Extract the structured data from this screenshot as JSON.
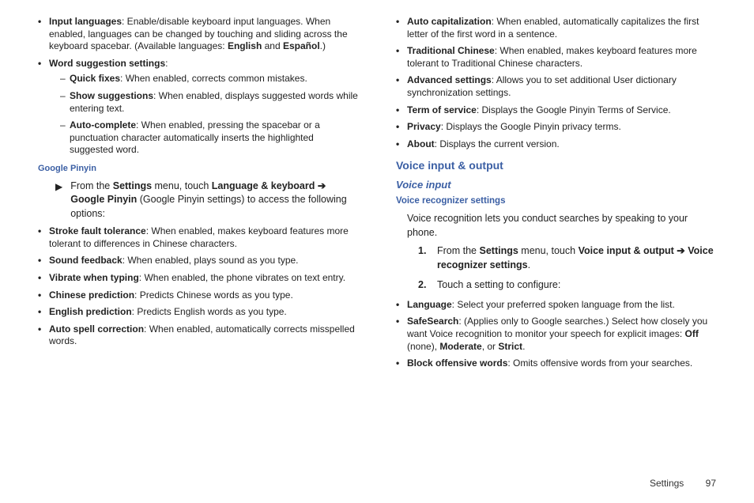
{
  "col1": {
    "b1_term": "Input languages",
    "b1_desc": ": Enable/disable keyboard input languages. When enabled, languages can be changed by touching and sliding across the keyboard spacebar. (Available languages: ",
    "b1_lang1": "English",
    "b1_and": " and ",
    "b1_lang2": "Español",
    "b1_end": ".)",
    "b2_term": "Word suggestion settings",
    "b2_colon": ":",
    "d1_term": "Quick fixes",
    "d1_desc": ": When enabled, corrects common mistakes.",
    "d2_term": "Show suggestions",
    "d2_desc": ": When enabled, displays suggested words while entering text.",
    "d3_term": "Auto-complete",
    "d3_desc": ": When enabled, pressing the spacebar or a punctuation character automatically inserts the highlighted suggested word.",
    "gp_heading": "Google Pinyin",
    "gp_intro_pre": "From the ",
    "gp_intro_settings": "Settings",
    "gp_intro_mid": " menu, touch ",
    "gp_intro_link": "Language & keyboard ➔ Google Pinyin",
    "gp_intro_post": " (Google Pinyin settings) to access the following options:",
    "gp_b1_term": "Stroke fault tolerance",
    "gp_b1_desc": ": When enabled, makes keyboard features more tolerant to differences in Chinese characters.",
    "gp_b2_term": "Sound feedback",
    "gp_b2_desc": ": When enabled, plays sound as you type.",
    "gp_b3_term": "Vibrate when typing",
    "gp_b3_desc": ": When enabled, the phone vibrates on text entry.",
    "gp_b4_term": "Chinese prediction",
    "gp_b4_desc": ": Predicts Chinese words as you type.",
    "gp_b5_term": "English prediction",
    "gp_b5_desc": ": Predicts English words as you type.",
    "gp_b6_term": "Auto spell correction",
    "gp_b6_desc": ": When enabled, automatically corrects misspelled words."
  },
  "col2": {
    "b1_term": "Auto capitalization",
    "b1_desc": ": When enabled, automatically capitalizes the first letter of the first word in a sentence.",
    "b2_term": "Traditional Chinese",
    "b2_desc": ": When enabled, makes keyboard features more tolerant to Traditional Chinese characters.",
    "b3_term": "Advanced settings",
    "b3_desc": ": Allows you to set additional User dictionary synchronization settings.",
    "b4_term": "Term of service",
    "b4_desc": ": Displays the Google Pinyin Terms of Service.",
    "b5_term": "Privacy",
    "b5_desc": ": Displays the Google Pinyin privacy terms.",
    "b6_term": "About",
    "b6_desc": ": Displays the current version.",
    "vio_heading": "Voice input & output",
    "vi_heading": "Voice input",
    "vrs_heading": "Voice recognizer settings",
    "vr_para": "Voice recognition lets you conduct searches by speaking to your phone.",
    "s1_pre": "From the ",
    "s1_settings": "Settings",
    "s1_mid": " menu, touch ",
    "s1_link": "Voice input & output ➔ Voice recognizer settings",
    "s1_end": ".",
    "s2_text": "Touch a setting to configure:",
    "sb1_term": "Language",
    "sb1_desc": ": Select your preferred spoken language from the list.",
    "sb2_term": "SafeSearch",
    "sb2_desc_pre": ": (Applies only to Google searches.) Select how closely you want Voice recognition to monitor your speech for explicit images: ",
    "sb2_off": "Off",
    "sb2_off_post": " (none), ",
    "sb2_mod": "Moderate",
    "sb2_mod_post": ", or ",
    "sb2_strict": "Strict",
    "sb2_end": ".",
    "sb3_term": "Block offensive words",
    "sb3_desc": ": Omits offensive words from your searches."
  },
  "footer": {
    "section": "Settings",
    "page": "97"
  }
}
